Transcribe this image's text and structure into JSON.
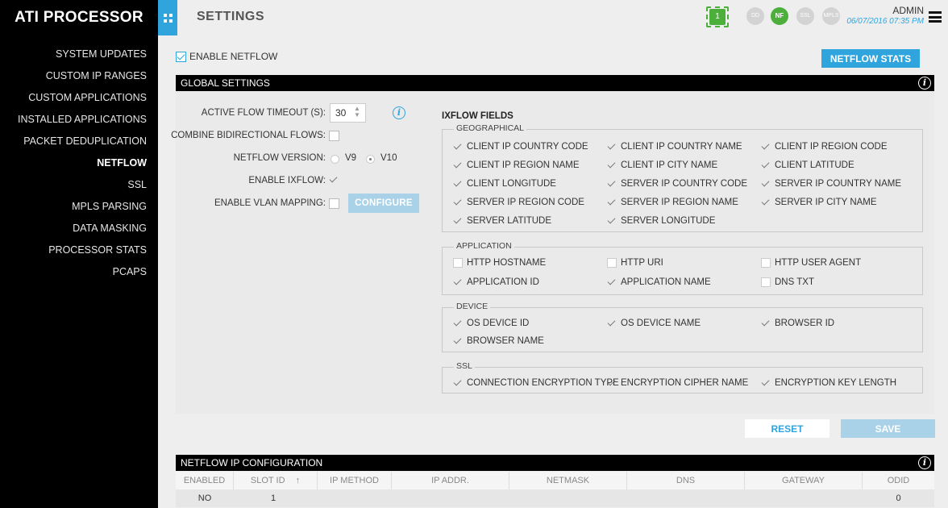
{
  "app": {
    "brand": "ATI PROCESSOR",
    "page_title": "SETTINGS"
  },
  "header": {
    "chip_count": "1",
    "status": [
      "DD",
      "NF",
      "SSL",
      "MPLS"
    ],
    "user": "ADMIN",
    "datetime": "06/07/2016 07:35 PM"
  },
  "sidebar": {
    "items": [
      {
        "label": "SYSTEM UPDATES"
      },
      {
        "label": "CUSTOM IP RANGES"
      },
      {
        "label": "CUSTOM APPLICATIONS"
      },
      {
        "label": "INSTALLED APPLICATIONS"
      },
      {
        "label": "PACKET DEDUPLICATION"
      },
      {
        "label": "NETFLOW",
        "active": true
      },
      {
        "label": "SSL"
      },
      {
        "label": "MPLS PARSING"
      },
      {
        "label": "DATA MASKING"
      },
      {
        "label": "PROCESSOR STATS"
      },
      {
        "label": "PCAPS"
      }
    ]
  },
  "main": {
    "enable_netflow": {
      "label": "ENABLE NETFLOW",
      "checked": true
    },
    "netflow_stats_label": "NETFLOW STATS",
    "global_settings": {
      "title": "GLOBAL SETTINGS",
      "active_flow_timeout_label": "ACTIVE FLOW TIMEOUT (S):",
      "active_flow_timeout_value": "30",
      "combine_bidirectional_label": "COMBINE BIDIRECTIONAL FLOWS:",
      "netflow_version_label": "NETFLOW VERSION:",
      "version_v9": "V9",
      "version_v10": "V10",
      "selected_version": "V10",
      "enable_ixflow_label": "ENABLE IXFLOW:",
      "enable_vlan_label": "ENABLE VLAN MAPPING:",
      "configure_label": "CONFIGURE"
    },
    "ixflow": {
      "title": "IXFLOW FIELDS",
      "geographical": {
        "legend": "GEOGRAPHICAL",
        "fields": [
          {
            "label": "CLIENT IP COUNTRY CODE",
            "checked": true
          },
          {
            "label": "CLIENT IP COUNTRY NAME",
            "checked": true
          },
          {
            "label": "CLIENT IP REGION CODE",
            "checked": true
          },
          {
            "label": "CLIENT IP REGION NAME",
            "checked": true
          },
          {
            "label": "CLIENT IP CITY NAME",
            "checked": true
          },
          {
            "label": "CLIENT LATITUDE",
            "checked": true
          },
          {
            "label": "CLIENT LONGITUDE",
            "checked": true
          },
          {
            "label": "SERVER IP COUNTRY CODE",
            "checked": true
          },
          {
            "label": "SERVER IP COUNTRY NAME",
            "checked": true
          },
          {
            "label": "SERVER IP REGION CODE",
            "checked": true
          },
          {
            "label": "SERVER IP REGION NAME",
            "checked": true
          },
          {
            "label": "SERVER IP CITY NAME",
            "checked": true
          },
          {
            "label": "SERVER LATITUDE",
            "checked": true
          },
          {
            "label": "SERVER LONGITUDE",
            "checked": true
          }
        ]
      },
      "application": {
        "legend": "APPLICATION",
        "fields": [
          {
            "label": "HTTP HOSTNAME",
            "checked": false
          },
          {
            "label": "HTTP URI",
            "checked": false
          },
          {
            "label": "HTTP USER AGENT",
            "checked": false
          },
          {
            "label": "APPLICATION ID",
            "checked": true
          },
          {
            "label": "APPLICATION NAME",
            "checked": true
          },
          {
            "label": "DNS TXT",
            "checked": false
          }
        ]
      },
      "device": {
        "legend": "DEVICE",
        "fields": [
          {
            "label": "OS DEVICE ID",
            "checked": true
          },
          {
            "label": "OS DEVICE NAME",
            "checked": true
          },
          {
            "label": "BROWSER ID",
            "checked": true
          },
          {
            "label": "BROWSER NAME",
            "checked": true
          }
        ]
      },
      "ssl": {
        "legend": "SSL",
        "fields": [
          {
            "label": "CONNECTION ENCRYPTION TYPE",
            "checked": true
          },
          {
            "label": "ENCRYPTION CIPHER NAME",
            "checked": true
          },
          {
            "label": "ENCRYPTION KEY LENGTH",
            "checked": true
          }
        ]
      }
    },
    "reset_label": "RESET",
    "save_label": "SAVE",
    "ip_config": {
      "title": "NETFLOW IP CONFIGURATION",
      "columns": [
        "ENABLED",
        "SLOT ID",
        "IP METHOD",
        "IP ADDR.",
        "NETMASK",
        "DNS",
        "GATEWAY",
        "ODID"
      ],
      "sort_indicator": "↑",
      "rows": [
        [
          "NO",
          "1",
          "",
          "",
          "",
          "",
          "",
          "0"
        ]
      ]
    }
  }
}
